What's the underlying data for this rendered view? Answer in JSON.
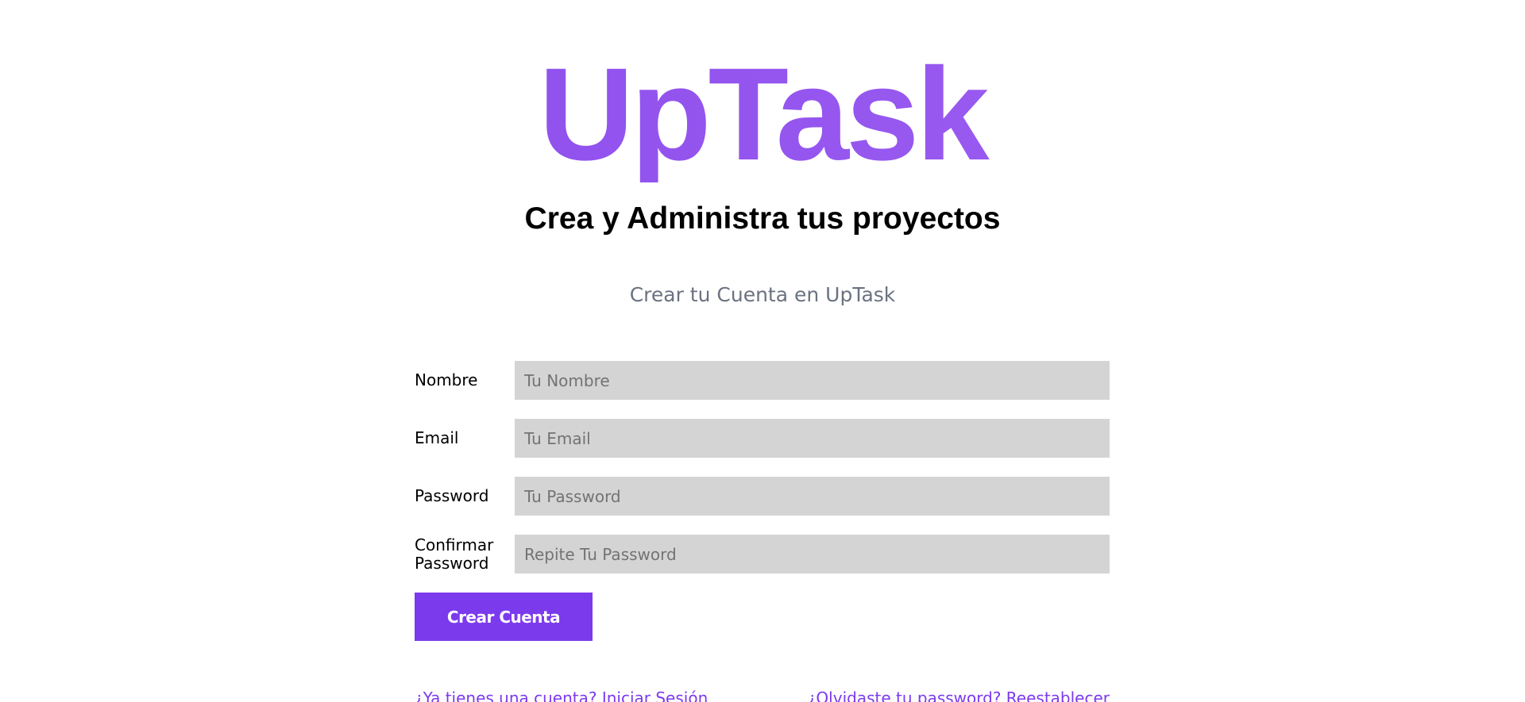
{
  "header": {
    "logo": "UpTask",
    "tagline": "Crea y Administra tus proyectos"
  },
  "form": {
    "heading": "Crear tu Cuenta en UpTask",
    "fields": [
      {
        "label": "Nombre",
        "placeholder": "Tu Nombre",
        "value": ""
      },
      {
        "label": "Email",
        "placeholder": "Tu Email",
        "value": ""
      },
      {
        "label": "Password",
        "placeholder": "Tu Password",
        "value": ""
      },
      {
        "label": "Confirmar Password",
        "placeholder": "Repite Tu Password",
        "value": ""
      }
    ],
    "submit_label": "Crear Cuenta"
  },
  "links": {
    "login": "¿Ya tienes una cuenta? Iniciar Sesión",
    "forgot": "¿Olvidaste tu password? Reestablecer"
  },
  "colors": {
    "brand": "#8b4aed",
    "button": "#7c3aed",
    "input_bg": "#d4d4d4",
    "link": "#7c3aed",
    "subheading": "#6b7280"
  }
}
